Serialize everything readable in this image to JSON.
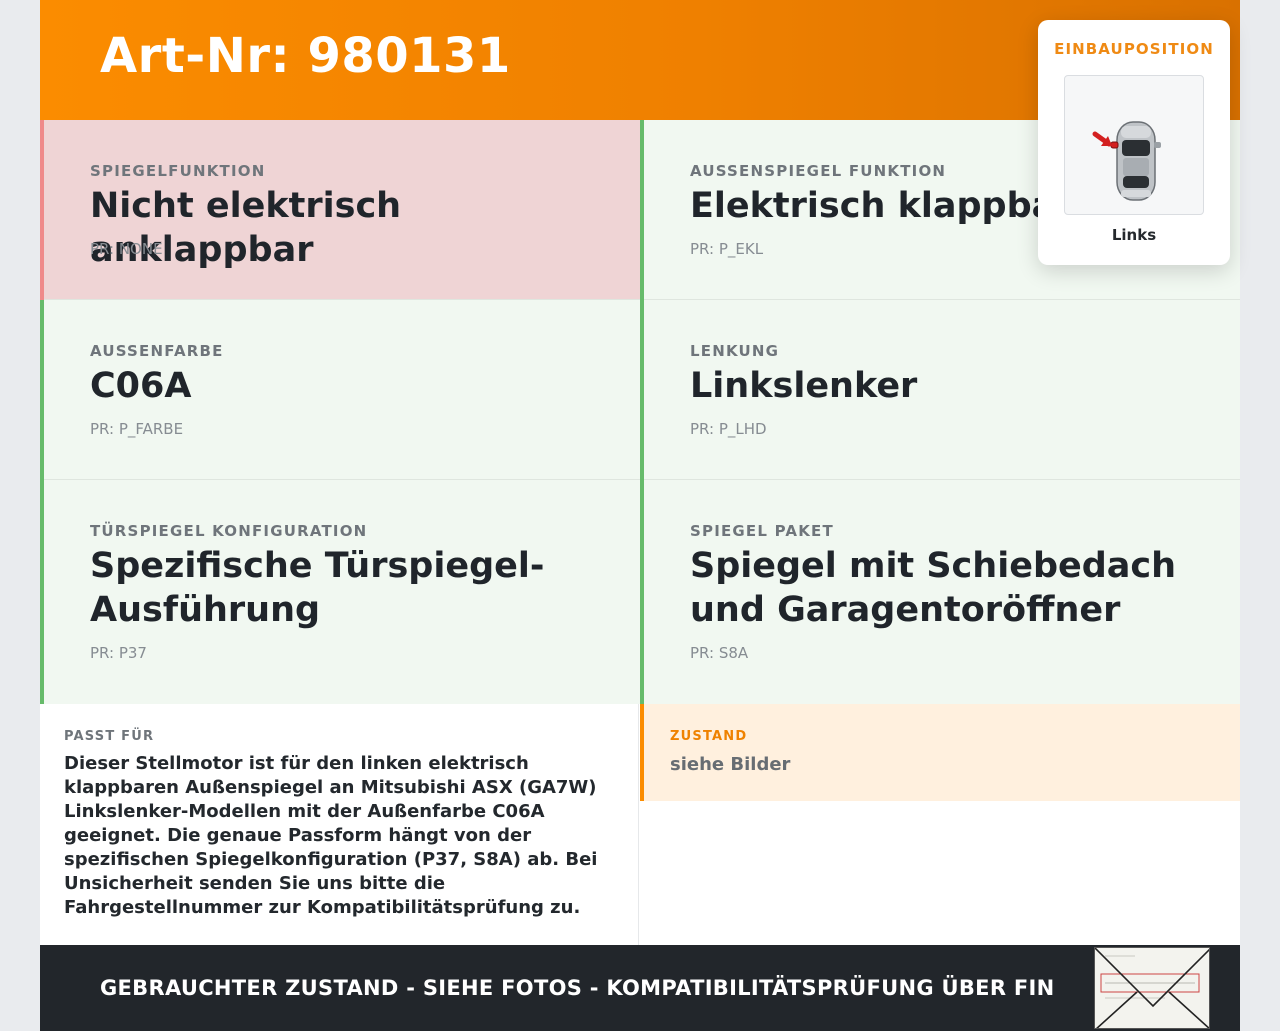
{
  "header": {
    "title": "Art-Nr: 980131"
  },
  "einbauposition": {
    "title": "EINBAUPOSITION",
    "position": "Links"
  },
  "attributes": [
    {
      "label": "SPIEGELFUNKTION",
      "value": "Nicht elektrisch anklappbar",
      "pr": "PR: NONE",
      "status": "mismatch"
    },
    {
      "label": "AUSSENSPIEGEL FUNKTION",
      "value": "Elektrisch klappbar",
      "pr": "PR: P_EKL",
      "status": "match"
    },
    {
      "label": "AUSSENFARBE",
      "value": "C06A",
      "pr": "PR: P_FARBE",
      "status": "match"
    },
    {
      "label": "LENKUNG",
      "value": "Linkslenker",
      "pr": "PR: P_LHD",
      "status": "match"
    },
    {
      "label": "TÜRSPIEGEL KONFIGURATION",
      "value": "Spezifische Türspiegel-Ausführung",
      "pr": "PR: P37",
      "status": "match"
    },
    {
      "label": "SPIEGEL PAKET",
      "value": "Spiegel mit Schiebedach und Garagentoröffner",
      "pr": "PR: S8A",
      "status": "match"
    }
  ],
  "passt_fuer": {
    "label": "PASST FÜR",
    "text": "Dieser Stellmotor ist für den linken elektrisch klappbaren Außenspiegel an Mitsubishi ASX (GA7W) Linkslenker-Modellen mit der Außenfarbe C06A geeignet. Die genaue Passform hängt von der spezifischen Spiegelkonfiguration (P37, S8A) ab. Bei Unsicherheit senden Sie uns bitte die Fahrgestellnummer zur Kompatibilitätsprüfung zu."
  },
  "zustand": {
    "label": "ZUSTAND",
    "value": "siehe Bilder"
  },
  "footer": {
    "text": "GEBRAUCHTER ZUSTAND - SIEHE FOTOS - KOMPATIBILITÄTSPRÜFUNG ÜBER FIN",
    "envelope_icon": "envelope-label-icon"
  },
  "colors": {
    "header": "#fb8c00",
    "match_border": "#66bb6a",
    "match_bg": "#f1f8f1",
    "mismatch_border": "#ef8a8a",
    "mismatch_bg": "#efd4d5",
    "footer_bg": "#22262b"
  }
}
